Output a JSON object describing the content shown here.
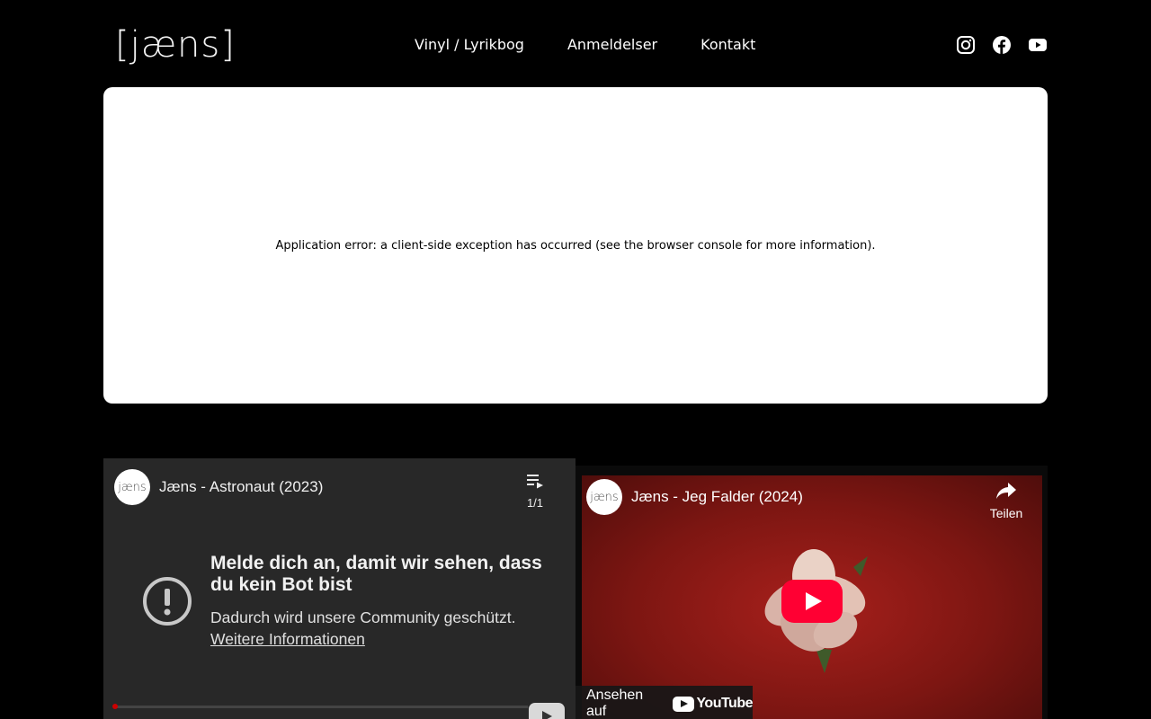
{
  "header": {
    "logo": "[jæns]",
    "nav": [
      {
        "label": "Vinyl / Lyrikbog"
      },
      {
        "label": "Anmeldelser"
      },
      {
        "label": "Kontakt"
      }
    ],
    "socials": [
      "instagram-icon",
      "facebook-icon",
      "youtube-icon"
    ]
  },
  "error": {
    "message": "Application error: a client-side exception has occurred (see the browser console for more information)."
  },
  "video1": {
    "avatar": "jæns",
    "title": "Jæns - Astronaut (2023)",
    "playlist_count": "1/1",
    "heading": "Melde dich an, damit wir sehen, dass du kein Bot bist",
    "body": "Dadurch wird unsere Community geschützt.",
    "link": "Weitere Informationen"
  },
  "video2": {
    "avatar": "jæns",
    "title": "Jæns - Jeg Falder (2024)",
    "share_label": "Teilen",
    "watch_on": "Ansehen auf",
    "yt_brand": "YouTube"
  },
  "colors": {
    "background": "#000000",
    "panel": "#ffffff",
    "youtube_red": "#ff0033"
  }
}
